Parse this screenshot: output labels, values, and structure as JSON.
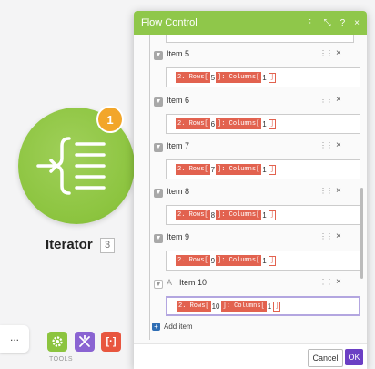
{
  "module": {
    "name": "Iterator",
    "number": "3",
    "badge": "1",
    "color": "#8cc43f"
  },
  "left_menu": {
    "dots_label": "..."
  },
  "tools": {
    "label": "TOOLS",
    "items": [
      {
        "icon": "gear-icon",
        "color": "#8cc43f"
      },
      {
        "icon": "flow-control-icon",
        "color": "#8a63d2"
      },
      {
        "icon": "brackets-icon",
        "label": "[·]",
        "color": "#e8563f"
      }
    ]
  },
  "panel": {
    "title": "Flow Control",
    "header_icons": [
      "more-icon",
      "expand-icon",
      "help-icon",
      "close-icon"
    ],
    "items": [
      {
        "label": "Item 5",
        "pill1": "2. Rows[",
        "row": "5",
        "pill2": "]: Columns[",
        "col": "1",
        "pill3": "]"
      },
      {
        "label": "Item 6",
        "pill1": "2. Rows[",
        "row": "6",
        "pill2": "]: Columns[",
        "col": "1",
        "pill3": "]"
      },
      {
        "label": "Item 7",
        "pill1": "2. Rows[",
        "row": "7",
        "pill2": "]: Columns[",
        "col": "1",
        "pill3": "]"
      },
      {
        "label": "Item 8",
        "pill1": "2. Rows[",
        "row": "8",
        "pill2": "]: Columns[",
        "col": "1",
        "pill3": "]"
      },
      {
        "label": "Item 9",
        "pill1": "2. Rows[",
        "row": "9",
        "pill2": "]: Columns[",
        "col": "1",
        "pill3": "]"
      },
      {
        "label": "Item 10",
        "pill1": "2. Rows[",
        "row": "10",
        "pill2": "]: Columns[",
        "col": "1",
        "pill3": "]",
        "prefix": "A"
      }
    ],
    "add_item": "Add item",
    "cancel": "Cancel",
    "ok": "OK",
    "accent": "#6b3fc4",
    "pill_color": "#e2624f"
  }
}
